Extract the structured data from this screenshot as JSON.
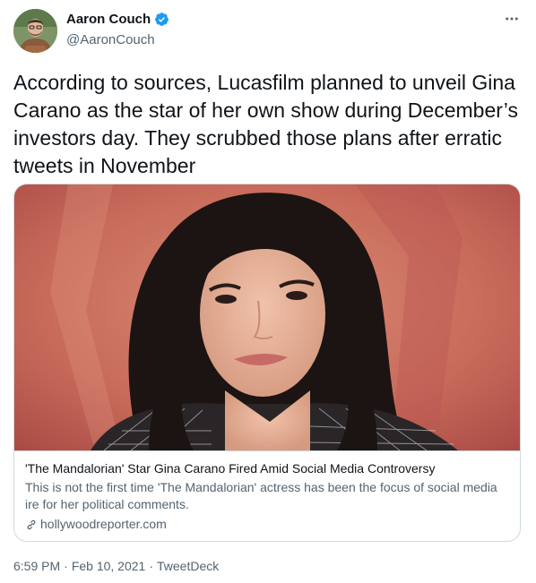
{
  "author": {
    "name": "Aaron Couch",
    "handle": "@AaronCouch",
    "verified": true
  },
  "tweet": {
    "text": "According to sources, Lucasfilm planned to unveil Gina Carano as the star of her own show during December’s investors day. They scrubbed those plans after erratic tweets in November"
  },
  "card": {
    "title": "'The Mandalorian' Star Gina Carano Fired Amid Social Media Controversy",
    "description": "This is not the first time 'The Mandalorian' actress has been the focus of social media ire for her political comments.",
    "domain": "hollywoodreporter.com"
  },
  "meta": {
    "time": "6:59 PM",
    "date": "Feb 10, 2021",
    "source": "TweetDeck",
    "separator": "·"
  },
  "icons": {
    "more": "more-horizontal-icon",
    "verified": "verified-badge-icon",
    "link": "link-icon"
  },
  "colors": {
    "verified": "#1d9bf0",
    "text": "#0f1419",
    "secondary": "#536471",
    "border": "#cfd9de"
  }
}
